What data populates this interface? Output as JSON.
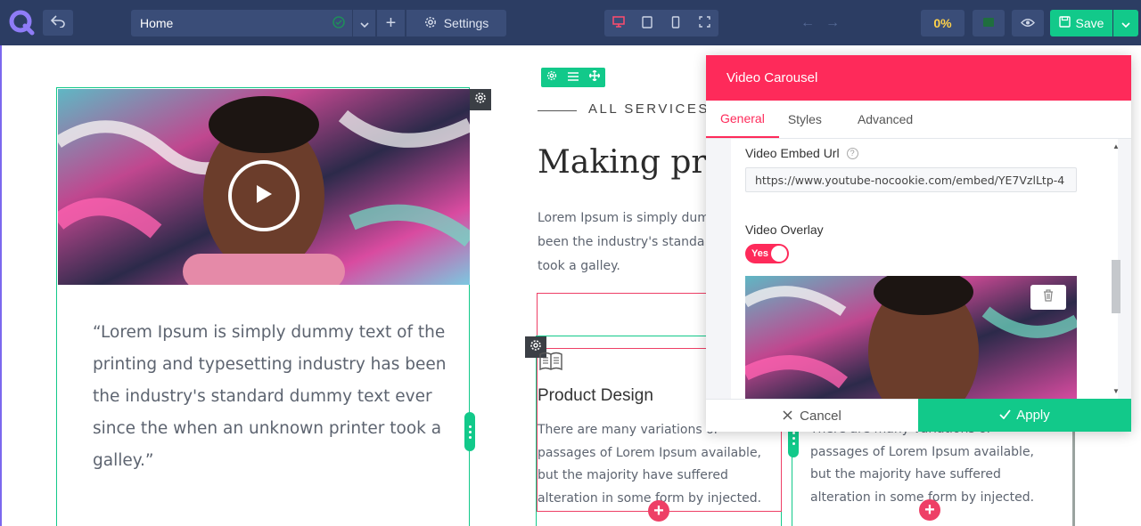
{
  "topbar": {
    "page_name": "Home",
    "settings_label": "Settings",
    "progress": "0%",
    "save_label": "Save"
  },
  "canvas": {
    "quote": "“Lorem Ipsum is simply dummy text of the printing and typesetting industry has been the industry's standard dummy text ever since the when an unknown printer took a galley.”",
    "eyebrow": "ALL SERVICES",
    "heading": "Making pro",
    "paragraph_lines": [
      "Lorem Ipsum is simply dum",
      "been the industry's standa",
      "took a galley."
    ],
    "services": [
      {
        "title": "Product Design",
        "text_lines": [
          "There are many variations of",
          "passages of Lorem Ipsum available,",
          "but the majority have suffered",
          "alteration in some form by injected."
        ]
      },
      {
        "text_lines": [
          "There are many variations of",
          "passages of Lorem Ipsum available,",
          "but the majority have suffered",
          "alteration in some form by injected."
        ]
      }
    ]
  },
  "panel": {
    "title": "Video Carousel",
    "tabs": [
      "General",
      "Styles",
      "Advanced"
    ],
    "active_tab": "General",
    "embed_label": "Video Embed Url",
    "embed_value": "https://www.youtube-nocookie.com/embed/YE7VzlLtp-4",
    "overlay_label": "Video Overlay",
    "overlay_toggle": "Yes",
    "cancel_label": "Cancel",
    "apply_label": "Apply"
  },
  "colors": {
    "topbar": "#2c3d63",
    "accent_green": "#12c98a",
    "accent_red": "#fe2a5a",
    "progress_yellow": "#ffd24a"
  }
}
